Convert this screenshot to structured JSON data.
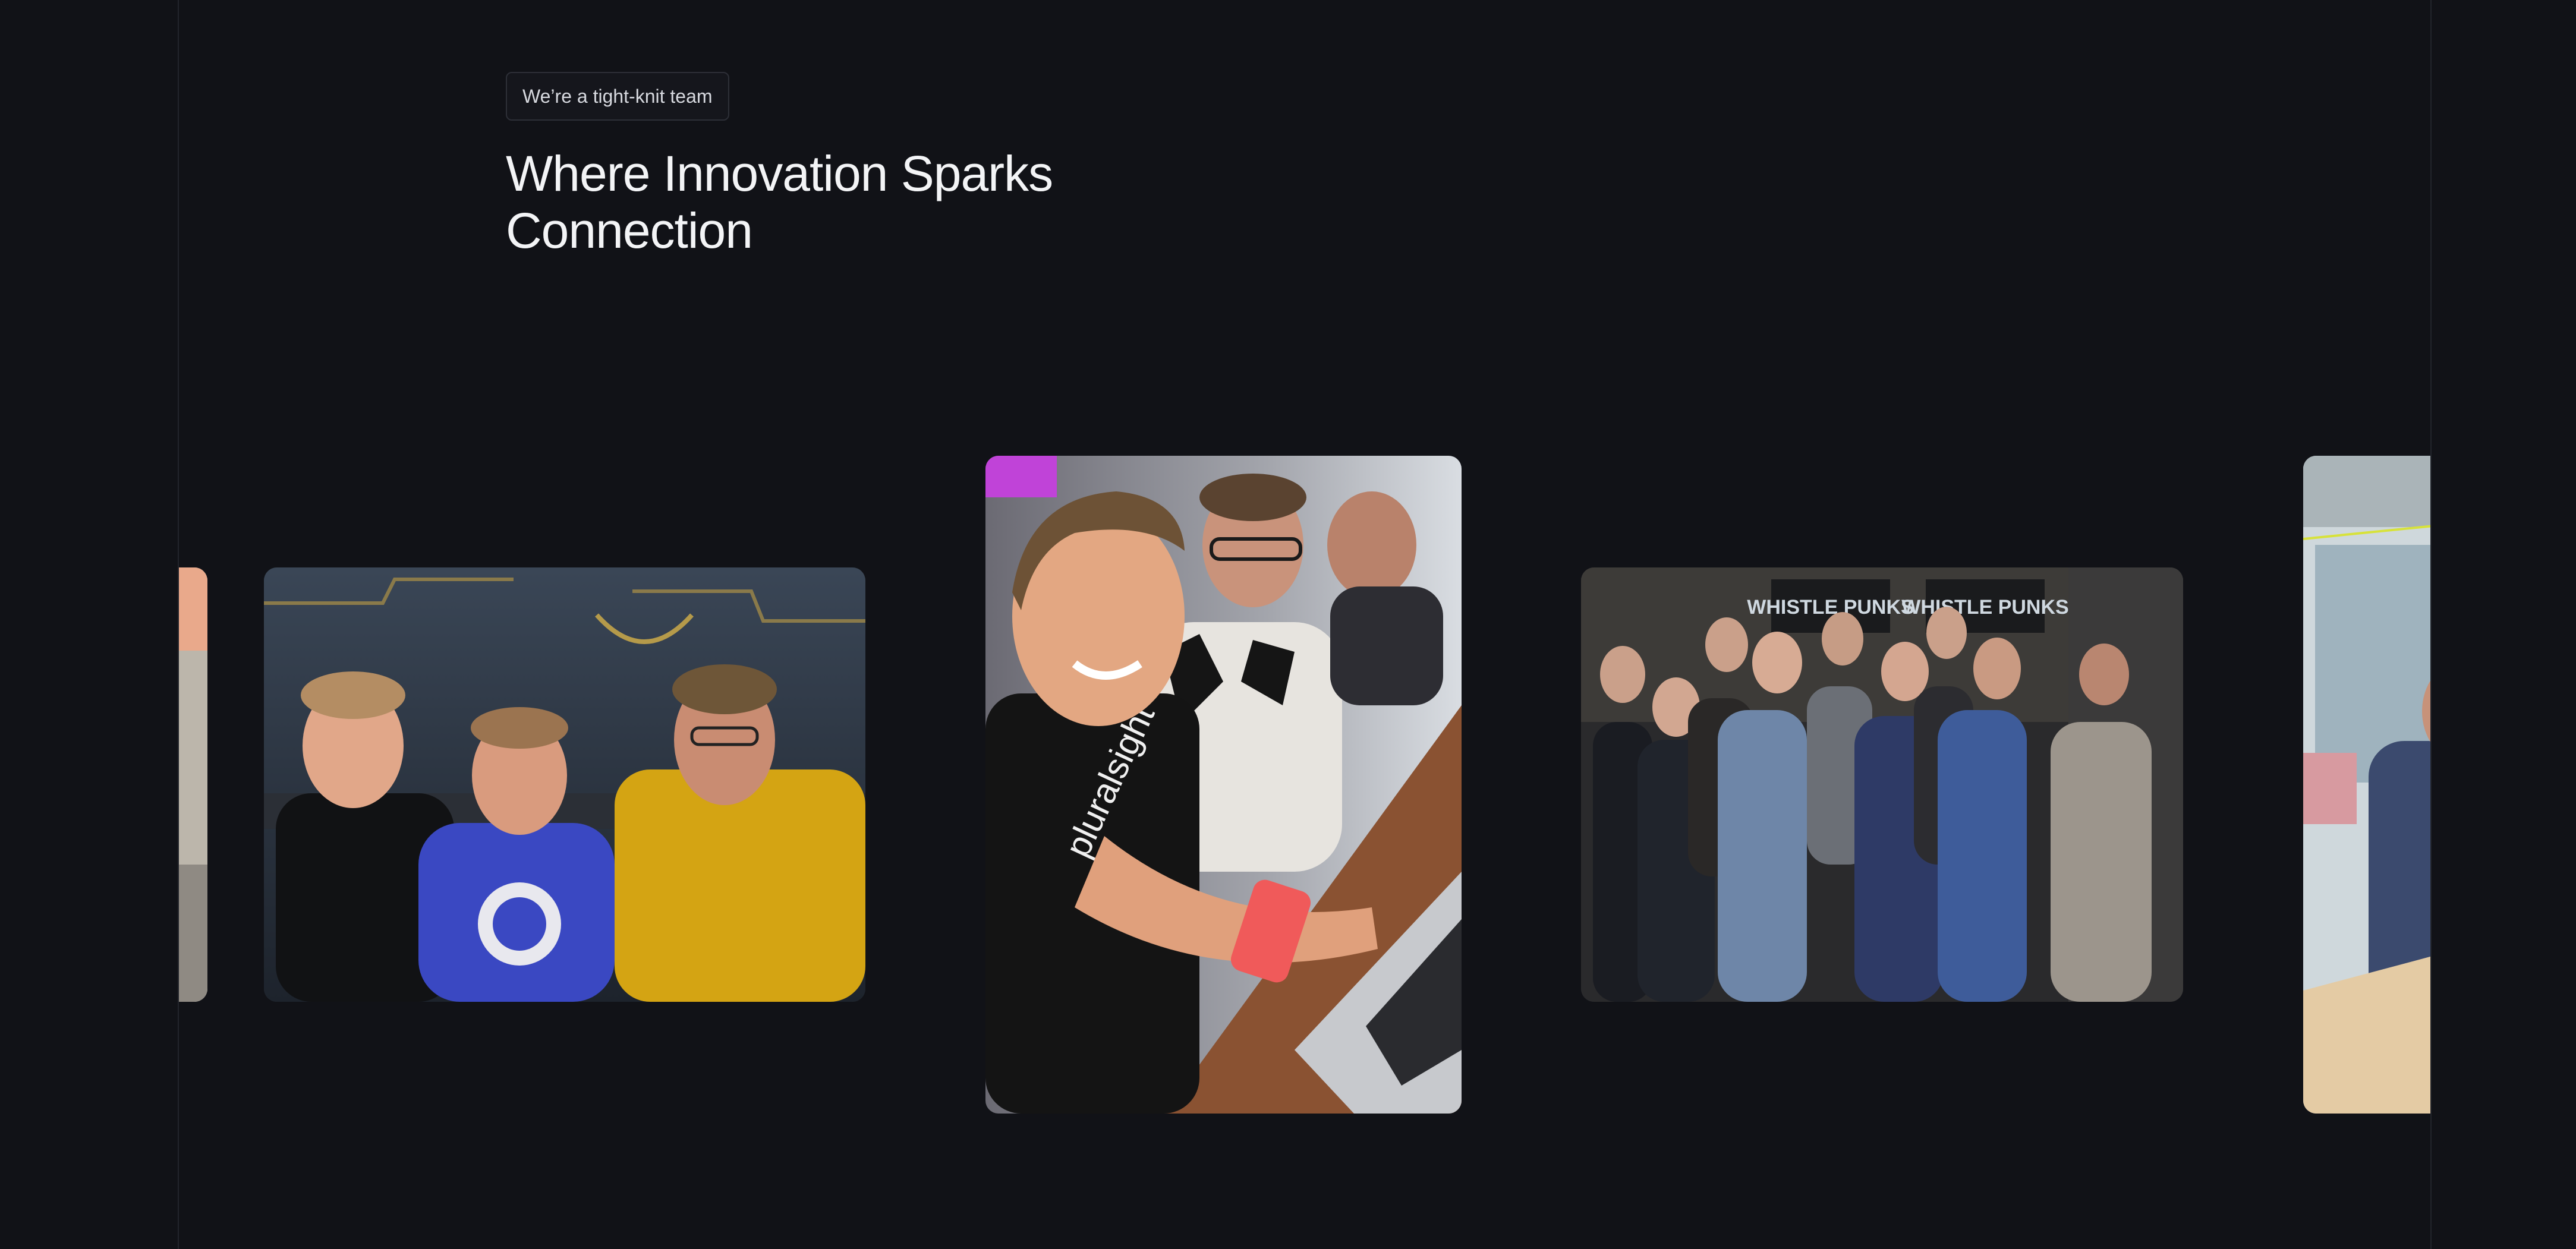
{
  "section": {
    "tag": "We’re a tight-knit team",
    "headline_line1": "Where Innovation Sparks",
    "headline_line2": "Connection"
  },
  "carousel": {
    "photos": [
      {
        "description": "partial photo at left edge, warm peach tones"
      },
      {
        "description": "three men smiling at a table in front of a dark mural"
      },
      {
        "description": "woman smiling while typing on a laptop, colleagues behind"
      },
      {
        "description": "group of ten people at an axe-throwing venue"
      },
      {
        "description": "partial photo at right edge, office with glass walls"
      }
    ],
    "venue_sign_text": "WHISTLE PUNKS"
  },
  "colors": {
    "background": "#111217",
    "text": "#f3f4f6",
    "pill_border": "#2d2f37",
    "guide_line": "#22242b"
  }
}
